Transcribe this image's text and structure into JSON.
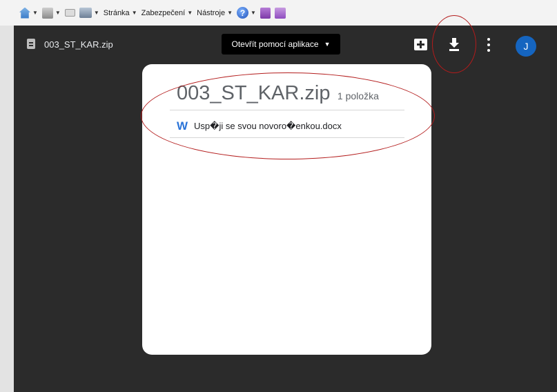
{
  "ie_toolbar": {
    "icons": [
      "home-icon",
      "rss-icon",
      "mail-icon",
      "print-icon",
      "help-icon",
      "onenote-icon",
      "onenote-send-icon"
    ],
    "menus": [
      "Stránka",
      "Zabezpečení",
      "Nástroje"
    ]
  },
  "viewer": {
    "file_name": "003_ST_KAR.zip",
    "open_with_label": "Otevřít pomocí aplikace",
    "avatar_initial": "J"
  },
  "zip": {
    "name": "003_ST_KAR.zip",
    "count_label": "1 položka",
    "entries": [
      {
        "icon": "word-icon",
        "icon_letter": "W",
        "name": "Usp�ji se svou novoro�enkou.docx"
      }
    ]
  },
  "colors": {
    "viewer_background": "#2b2b2b",
    "accent_blue": "#1565c0",
    "annotation_red": "#b31b1b"
  }
}
